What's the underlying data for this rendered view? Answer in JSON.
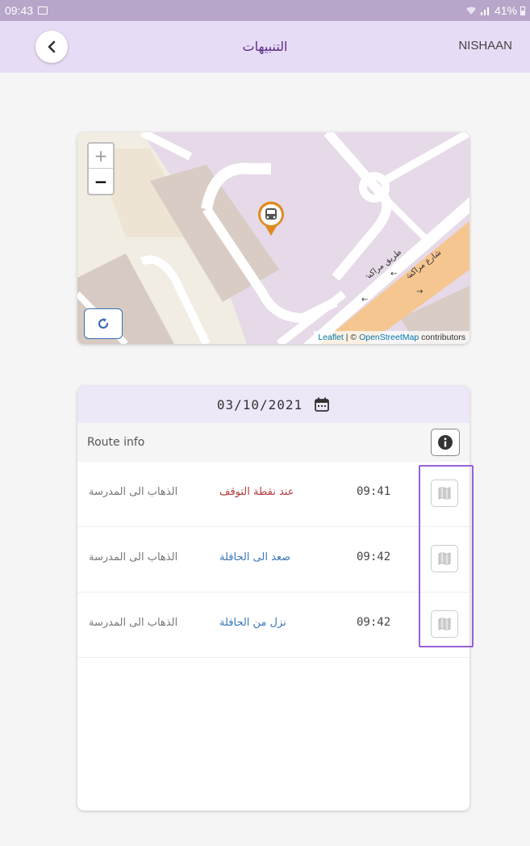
{
  "status_bar": {
    "time": "09:43",
    "battery": "41%"
  },
  "header": {
    "title": "التنبيهات",
    "user_name": "NISHAAN"
  },
  "map": {
    "zoom_in": "+",
    "zoom_out": "−",
    "attribution_leaflet": "Leaflet",
    "attribution_sep": " | © ",
    "attribution_osm": "OpenStreetMap",
    "attribution_suffix": " contributors",
    "street_1": "طريق مراكش",
    "street_2": "شارع مراكش"
  },
  "events": {
    "date": "03/10/2021",
    "route_label": "Route info",
    "rows": [
      {
        "trip": "الذهاب الى المدرسة",
        "event": "عند نقطة التوقف",
        "event_color": "#b23b3b",
        "time": "09:41"
      },
      {
        "trip": "الذهاب الى المدرسة",
        "event": "صعد الى الحافلة",
        "event_color": "#3a78b8",
        "time": "09:42"
      },
      {
        "trip": "الذهاب الى المدرسة",
        "event": "نزل من الحافلة",
        "event_color": "#3a78b8",
        "time": "09:42"
      }
    ]
  },
  "colors": {
    "header_bg": "#e7dcf5",
    "status_bg": "#b7a6c9",
    "title": "#5b2a86",
    "highlight": "#9a5fd8",
    "pin": "#e08a1e"
  }
}
